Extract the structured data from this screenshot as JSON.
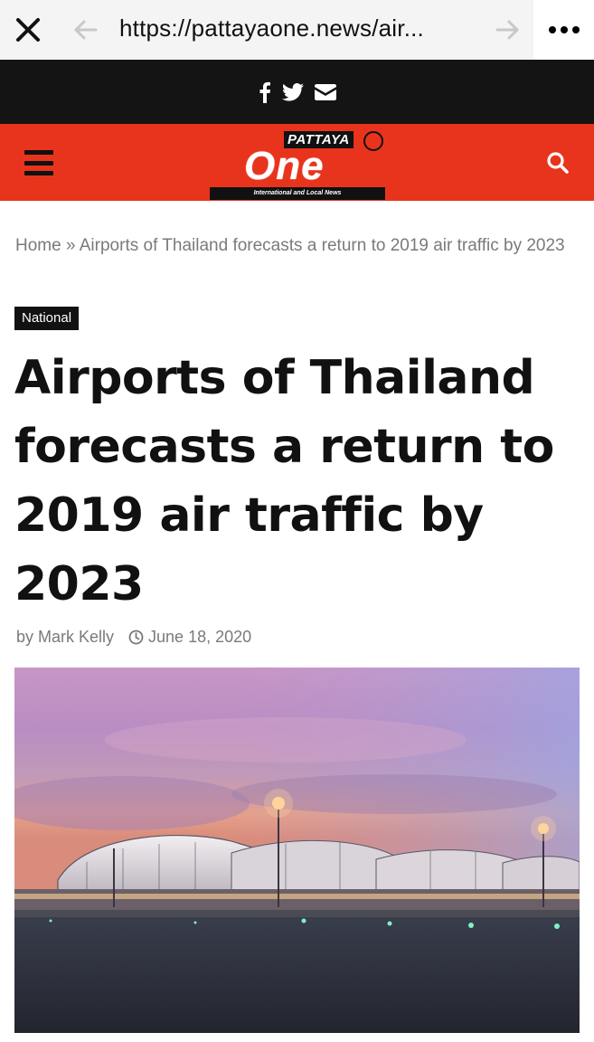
{
  "browser": {
    "url": "https://pattayaone.news/air..."
  },
  "social": {
    "icons": [
      "facebook-icon",
      "twitter-icon",
      "envelope-icon"
    ]
  },
  "header": {
    "logo_brand": "PATTAYA",
    "logo_name": "One",
    "logo_tagline": "International and Local News",
    "brand_color": "#e8341c"
  },
  "article": {
    "breadcrumb": "Home » Airports of Thailand forecasts a return to 2019 air traffic by 2023",
    "category": "National",
    "title": "Airports of Thailand forecasts a return to 2019 air traffic by 2023",
    "author": "by Mark Kelly",
    "date": "June 18, 2020"
  }
}
